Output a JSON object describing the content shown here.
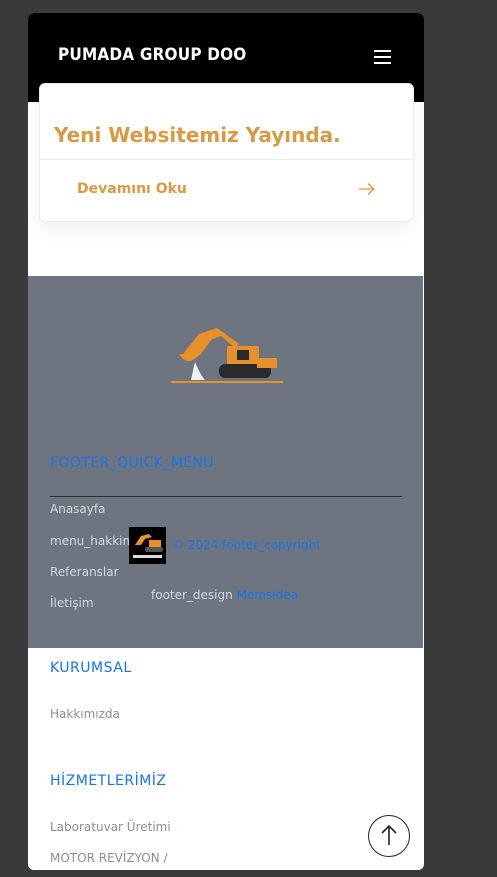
{
  "header": {
    "brand": "PUMADA GROUP DOO",
    "menu_icon": "hamburger-menu-icon"
  },
  "card": {
    "title": "Yeni Websitemiz Yayında.",
    "read_more": "Devamını Oku",
    "arrow_icon": "arrow-right-icon"
  },
  "footer": {
    "logo_icon": "excavator-logo-icon",
    "quick_menu_title": "FOOTER_QUICK_MENU",
    "quick_links": [
      "Anasayfa",
      "menu_hakkimizda",
      "Referanslar",
      "İletişim"
    ],
    "copyright": "© 2024 footer_copyright",
    "design_label": "footer_design",
    "design_link": "Memsidea"
  },
  "kurumsal": {
    "title": "KURUMSAL",
    "links": [
      "Hakkımızda"
    ]
  },
  "hizmetlerimiz": {
    "title": "HİZMETLERİMİZ",
    "links": [
      "Laboratuvar Üretimi",
      "MOTOR REVİZYON /"
    ]
  },
  "scroll_top_icon": "arrow-up-icon",
  "colors": {
    "accent": "#d99a45",
    "link": "#1a73e8",
    "footer_bg": "#6c7580",
    "header_bg": "#000000"
  }
}
